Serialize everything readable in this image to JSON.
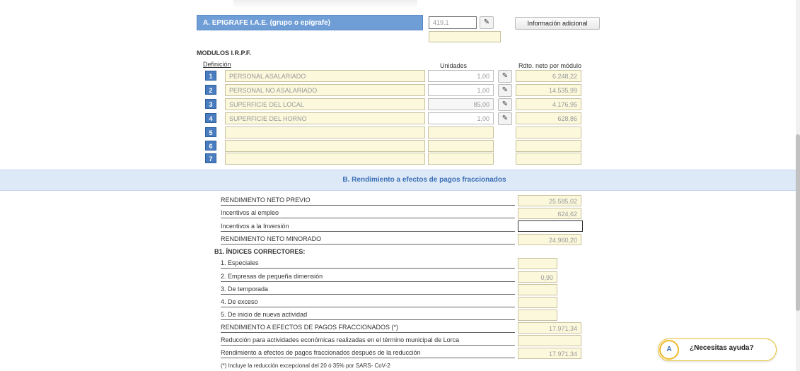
{
  "section_a": {
    "title": "A. EPIGRAFE I.A.E. (grupo o epígrafe)",
    "epigrafe_value": "419.1",
    "info_button": "Información adicional"
  },
  "modulos": {
    "heading": "MODULOS I.R.P.F.",
    "col_definicion": "Definición",
    "col_unidades": "Unidades",
    "col_rdto": "Rdto. neto por módulo",
    "rows": [
      {
        "num": "1",
        "definicion": "PERSONAL ASALARIADO",
        "unidades": "1,00",
        "rdto": "6.248,22"
      },
      {
        "num": "2",
        "definicion": "PERSONAL NO ASALARIADO",
        "unidades": "1,00",
        "rdto": "14.535,99"
      },
      {
        "num": "3",
        "definicion": "SUPERFICIE DEL LOCAL",
        "unidades": "85,00",
        "rdto": "4.176,95"
      },
      {
        "num": "4",
        "definicion": "SUPERFICIE DEL HORNO",
        "unidades": "1,00",
        "rdto": "628,86"
      },
      {
        "num": "5",
        "definicion": "",
        "unidades": "",
        "rdto": ""
      },
      {
        "num": "6",
        "definicion": "",
        "unidades": "",
        "rdto": ""
      },
      {
        "num": "7",
        "definicion": "",
        "unidades": "",
        "rdto": ""
      }
    ]
  },
  "section_b": {
    "title": "B. Rendimiento a efectos de pagos fraccionados",
    "rendimiento_neto_previo": {
      "label": "RENDIMIENTO NETO PREVIO",
      "value": "25.585,02"
    },
    "incentivos_empleo": {
      "label": "Incentivos al empleo",
      "value": "624,62"
    },
    "incentivos_inversion": {
      "label": "Incentivos a la Inversión",
      "value": ""
    },
    "rendimiento_neto_minorado": {
      "label": "RENDIMIENTO NETO MINORADO",
      "value": "24.960,20"
    },
    "indices_heading": "B1. ÍNDICES CORRECTORES:",
    "indices": [
      {
        "label": "1. Especiales",
        "value": ""
      },
      {
        "label": "2. Empresas de pequeña dimensión",
        "value": "0,90"
      },
      {
        "label": "3. De temporada",
        "value": ""
      },
      {
        "label": "4. De exceso",
        "value": ""
      },
      {
        "label": "5. De inicio de nueva actividad",
        "value": ""
      }
    ],
    "rendimiento_efectos": {
      "label": "RENDIMIENTO A EFECTOS DE PAGOS FRACCIONADOS (*)",
      "value": "17.971,34"
    },
    "reduccion_lorca": {
      "label": "Reducción para actividades económicas realizadas en el término municipal de Lorca",
      "value": ""
    },
    "rendimiento_despues": {
      "label": "Rendimiento a efectos de pagos fraccionados después de la reducción",
      "value": "17.971,34"
    },
    "footnote": "(*) Incluye la reducción excepcional del 20 ó 35% por SARS- CoV-2"
  },
  "help": {
    "logo": "A",
    "label": "¿Necesitas ayuda?"
  },
  "icons": {
    "edit": "pencil-icon"
  }
}
